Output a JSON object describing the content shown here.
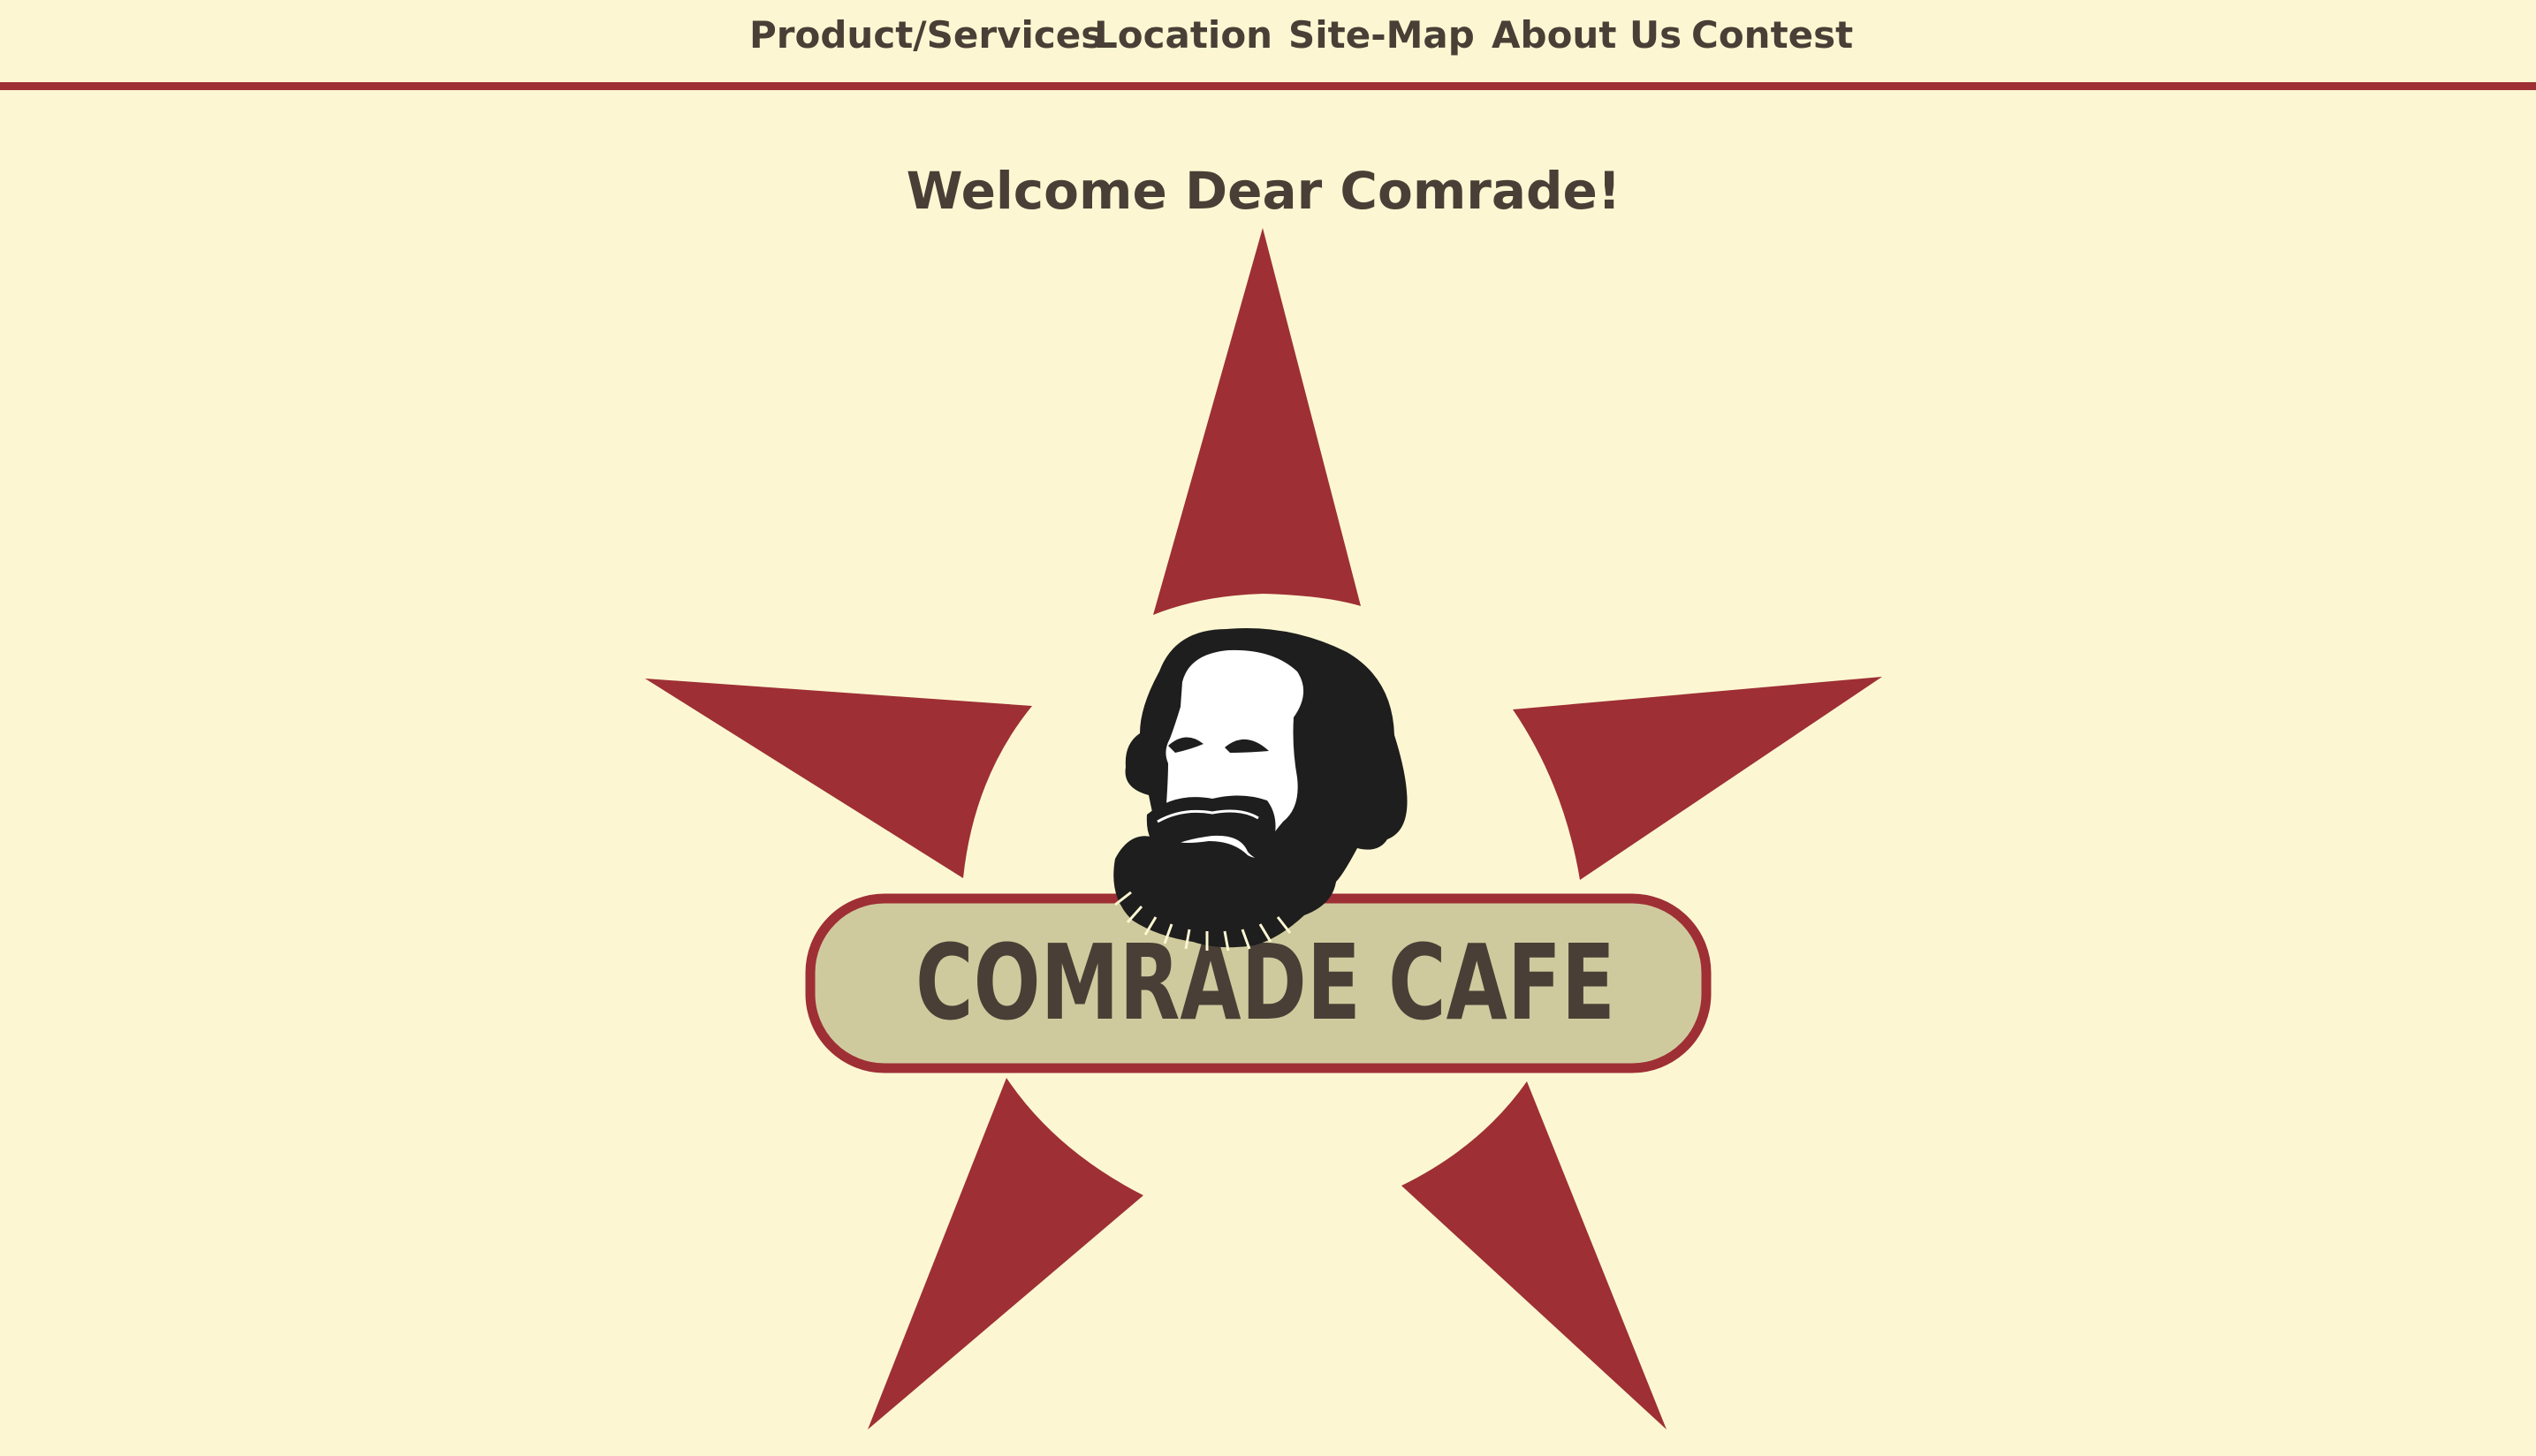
{
  "nav": {
    "items": [
      {
        "label": "Product/Services"
      },
      {
        "label": "Location"
      },
      {
        "label": "Site-Map"
      },
      {
        "label": "About Us"
      },
      {
        "label": "Contest"
      }
    ]
  },
  "main": {
    "heading": "Welcome Dear Comrade!"
  },
  "logo": {
    "name": "COMRADE CAFE",
    "icon": "red-star-with-bearded-portrait"
  },
  "colors": {
    "background": "#fcf7d2",
    "accent_red": "#9e2f35",
    "text": "#4a3f36",
    "banner_fill": "#cfca9d",
    "portrait": "#1e1e1e"
  }
}
